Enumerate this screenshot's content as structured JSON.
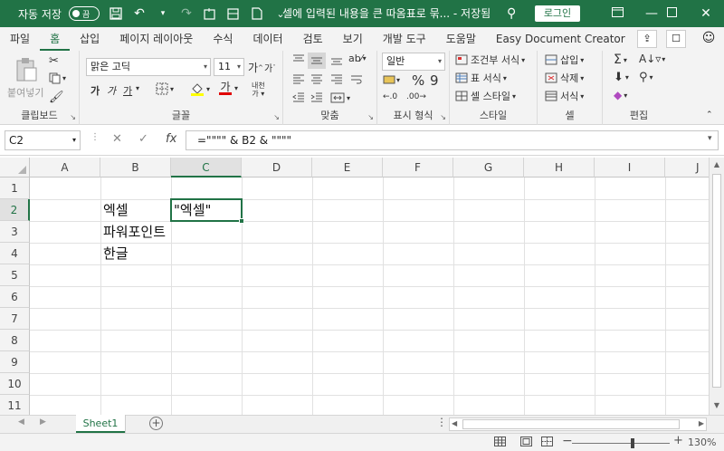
{
  "titlebar": {
    "autosave_label": "자동 저장",
    "autosave_state": "끔",
    "doc_title": "셀에 입력된 내용을 큰 따옴표로 묶... - 저장됨",
    "login_label": "로그인"
  },
  "tabs": [
    "파일",
    "홈",
    "삽입",
    "페이지 레이아웃",
    "수식",
    "데이터",
    "검토",
    "보기",
    "개발 도구",
    "도움말",
    "Easy Document Creator"
  ],
  "ribbon": {
    "clipboard": {
      "label": "클립보드",
      "paste": "붙여넣기"
    },
    "font": {
      "label": "글꼴",
      "name": "맑은 고딕",
      "size": "11",
      "grow": "가",
      "shrink": "가",
      "bold": "가",
      "italic": "가",
      "underline": "가",
      "color_a": "가",
      "phonetic": "내천"
    },
    "alignment": {
      "label": "맞춤"
    },
    "number": {
      "label": "표시 형식",
      "format": "일반",
      "percent": "%",
      "comma": "9"
    },
    "styles": {
      "label": "스타일",
      "conditional": "조건부 서식",
      "table": "표 서식",
      "cell": "셀 스타일"
    },
    "cells": {
      "label": "셀",
      "insert": "삽입",
      "delete": "삭제",
      "format": "서식"
    },
    "editing": {
      "label": "편집"
    }
  },
  "formula_bar": {
    "name_box": "C2",
    "fx": "fx",
    "formula": "=\"\"\"\" & B2 & \"\"\"\""
  },
  "grid": {
    "columns": [
      "A",
      "B",
      "C",
      "D",
      "E",
      "F",
      "G",
      "H",
      "I",
      "J"
    ],
    "rows": [
      "1",
      "2",
      "3",
      "4",
      "5",
      "6",
      "7",
      "8",
      "9",
      "10",
      "11"
    ],
    "cells": {
      "B2": "엑셀",
      "C2": "\"엑셀\"",
      "B3": "파워포인트",
      "B4": "한글"
    }
  },
  "sheets": [
    "Sheet1"
  ],
  "status": {
    "zoom": "130%",
    "zoom_level_percent": 130
  }
}
